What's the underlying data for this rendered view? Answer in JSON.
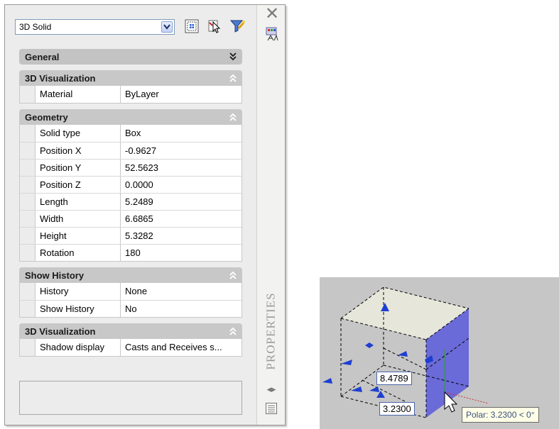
{
  "palette": {
    "title": "PROPERTIES",
    "object_type": "3D Solid",
    "sections": [
      {
        "title": "General",
        "collapsed": true,
        "rows": []
      },
      {
        "title": "3D Visualization",
        "collapsed": false,
        "rows": [
          {
            "name": "Material",
            "value": "ByLayer"
          }
        ]
      },
      {
        "title": "Geometry",
        "collapsed": false,
        "rows": [
          {
            "name": "Solid type",
            "value": "Box"
          },
          {
            "name": "Position X",
            "value": "-0.9627"
          },
          {
            "name": "Position Y",
            "value": "52.5623"
          },
          {
            "name": "Position Z",
            "value": "0.0000"
          },
          {
            "name": "Length",
            "value": "5.2489"
          },
          {
            "name": "Width",
            "value": "6.6865"
          },
          {
            "name": "Height",
            "value": "5.3282"
          },
          {
            "name": "Rotation",
            "value": "180"
          }
        ]
      },
      {
        "title": "Show History",
        "collapsed": false,
        "rows": [
          {
            "name": "History",
            "value": "None"
          },
          {
            "name": "Show History",
            "value": "No"
          }
        ]
      },
      {
        "title": "3D Visualization",
        "collapsed": false,
        "rows": [
          {
            "name": "Shadow display",
            "value": "Casts and Receives s..."
          }
        ]
      }
    ]
  },
  "viewport": {
    "dim_value_1": "8.4789",
    "dim_value_2": "3.2300",
    "polar_tooltip": "Polar: 3.2300 < 0°"
  },
  "colors": {
    "section_header": "#c8c8c8",
    "grip_blue": "#1e3fd0",
    "box_top": "#e6e6da",
    "box_side": "#6a6ad8"
  }
}
